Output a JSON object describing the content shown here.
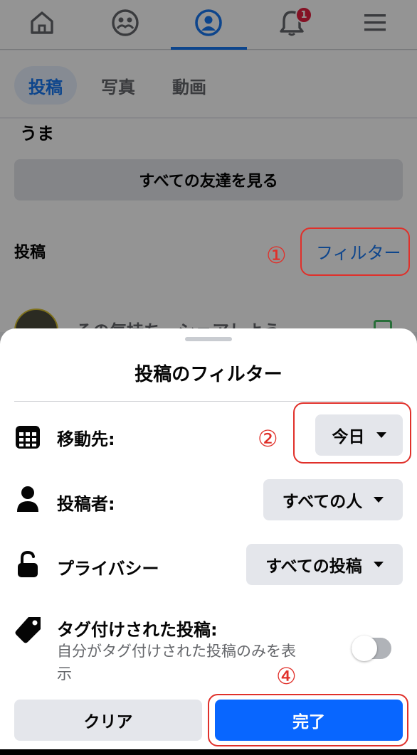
{
  "nav": {
    "items": [
      {
        "icon": "home-icon"
      },
      {
        "icon": "friends-icon"
      },
      {
        "icon": "profile-icon",
        "active": true
      },
      {
        "icon": "bell-icon",
        "badge": "1"
      },
      {
        "icon": "menu-icon"
      }
    ],
    "accent": "#1877f2"
  },
  "tabs": [
    {
      "label": "投稿",
      "active": true
    },
    {
      "label": "写真"
    },
    {
      "label": "動画"
    }
  ],
  "profile": {
    "friend_name_partial": "うま",
    "all_friends_button": "すべての友達を見る",
    "posts_heading": "投稿",
    "filter_link": "フィルター",
    "composer_placeholder": "その気持ち、シェアしよう"
  },
  "annotations": {
    "step1": "①",
    "step2": "②",
    "step4": "④",
    "color": "#e0302a"
  },
  "sheet": {
    "title": "投稿のフィルター",
    "rows": {
      "go_to": {
        "icon": "calendar-icon",
        "label": "移動先:",
        "value": "今日"
      },
      "posted_by": {
        "icon": "person-icon",
        "label": "投稿者:",
        "value": "すべての人"
      },
      "privacy": {
        "icon": "unlock-icon",
        "label": "プライバシー",
        "value": "すべての投稿"
      },
      "tagged": {
        "icon": "tag-icon",
        "label": "タグ付けされた投稿:",
        "sub_line1": "自分がタグ付けされた投稿のみを表",
        "sub_line2": "示",
        "enabled": false
      }
    },
    "clear_button": "クリア",
    "done_button": "完了",
    "done_color": "#0866ff"
  }
}
